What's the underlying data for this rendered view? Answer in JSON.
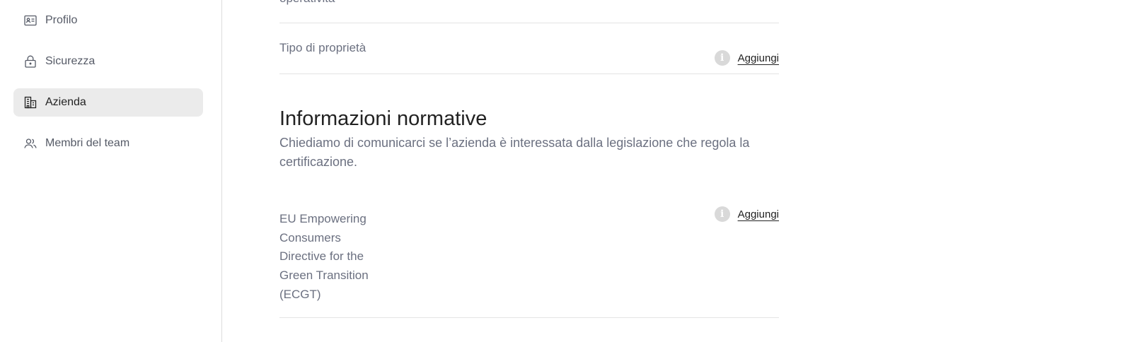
{
  "sidebar": {
    "items": [
      {
        "label": "Profilo",
        "icon": "id-card-icon",
        "active": false
      },
      {
        "label": "Sicurezza",
        "icon": "lock-icon",
        "active": false
      },
      {
        "label": "Azienda",
        "icon": "building-icon",
        "active": true
      },
      {
        "label": "Membri del team",
        "icon": "users-icon",
        "active": false
      }
    ]
  },
  "main": {
    "previous_row_label": "operatività",
    "ownership_row": {
      "label": "Tipo di proprietà",
      "info_icon": "info-icon",
      "action_label": "Aggiungi"
    },
    "regulatory_section": {
      "title": "Informazioni normative",
      "description": "Chiediamo di comunicarci se l’azienda è interessata dalla legislazione che regola la certificazione."
    },
    "ecgt_row": {
      "label": "EU Empowering Consumers Directive for the Green Transition (ECGT)",
      "info_icon": "info-icon",
      "action_label": "Aggiungi"
    }
  },
  "colors": {
    "active_nav_bg": "#ebebeb",
    "muted_text": "#6b7080",
    "divider": "#e4e4e4",
    "info_icon_bg": "#d9d9d9"
  }
}
